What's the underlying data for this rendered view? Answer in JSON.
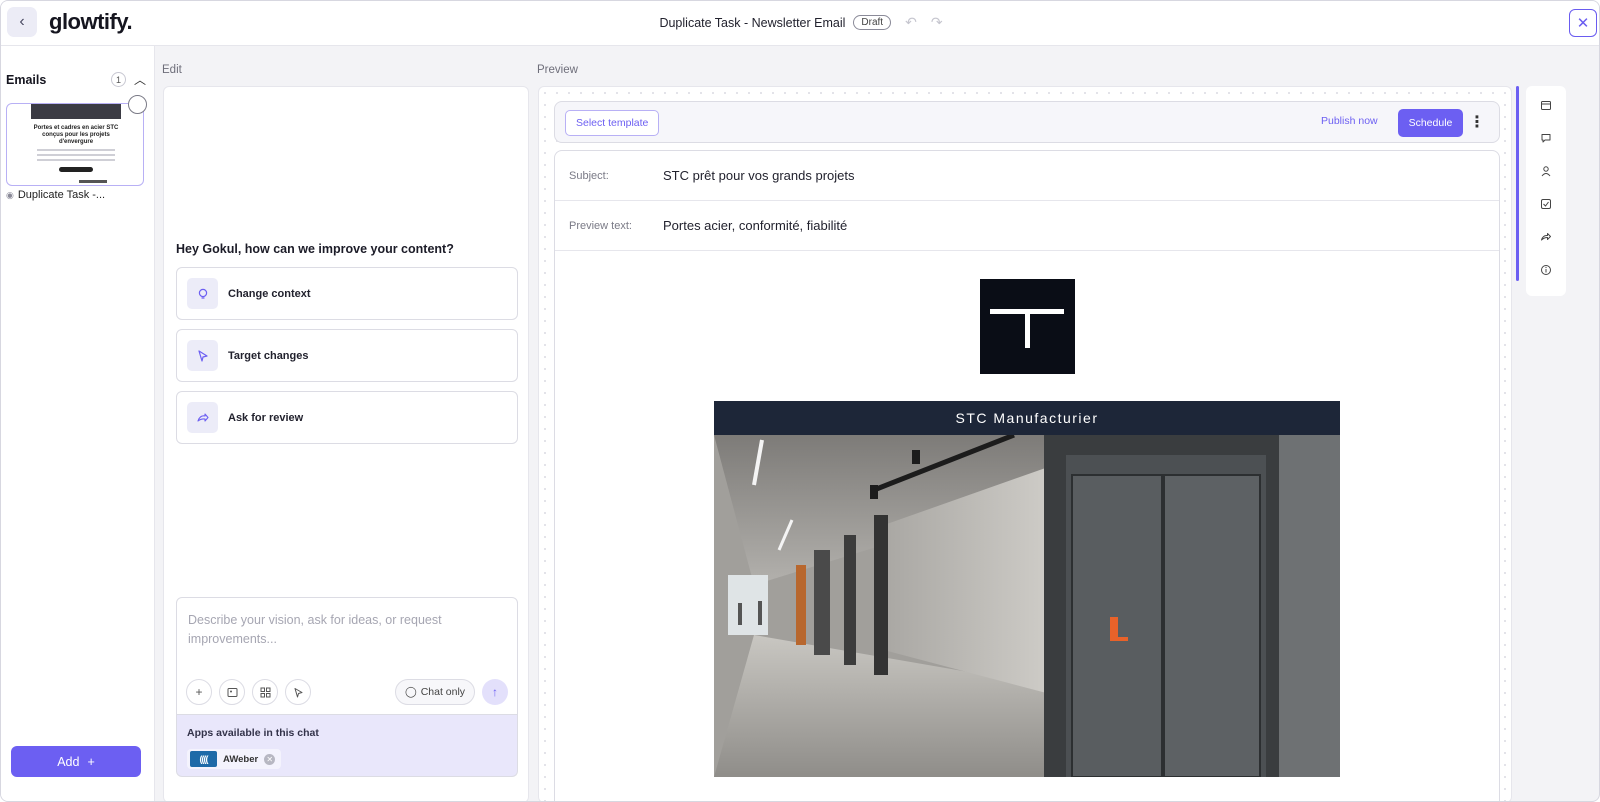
{
  "header": {
    "logo": "glowtify.",
    "title": "Duplicate Task - Newsletter Email",
    "status_badge": "Draft"
  },
  "sidebar": {
    "section_label": "Emails",
    "count": "1",
    "email_items": [
      {
        "caption": "Duplicate Task -...",
        "thumb_heading": "Portes et cadres en acier STC conçus pour les projets d'envergure"
      }
    ],
    "add_label": "Add"
  },
  "edit": {
    "section_label": "Edit",
    "greeting": "Hey Gokul, how can we improve your content?",
    "actions": [
      {
        "label": "Change context",
        "icon": "lightbulb-icon"
      },
      {
        "label": "Target changes",
        "icon": "cursor-icon"
      },
      {
        "label": "Ask for review",
        "icon": "share-icon"
      }
    ],
    "chat": {
      "placeholder": "Describe your vision, ask for ideas, or request improvements...",
      "chat_only_label": "Chat only"
    },
    "apps": {
      "label": "Apps available in this chat",
      "items": [
        {
          "name": "AWeber"
        }
      ]
    }
  },
  "preview": {
    "section_label": "Preview",
    "toolbar": {
      "select_template": "Select template",
      "publish_now": "Publish now",
      "schedule": "Schedule"
    },
    "subject_label": "Subject:",
    "subject_value": "STC prêt pour vos grands projets",
    "preview_text_label": "Preview text:",
    "preview_text_value": "Portes acier, conformité, fiabilité",
    "banner_text": "STC Manufacturier"
  },
  "colors": {
    "accent": "#6c5ff2",
    "banner": "#1d2638",
    "logo_bg": "#0a0d16"
  }
}
